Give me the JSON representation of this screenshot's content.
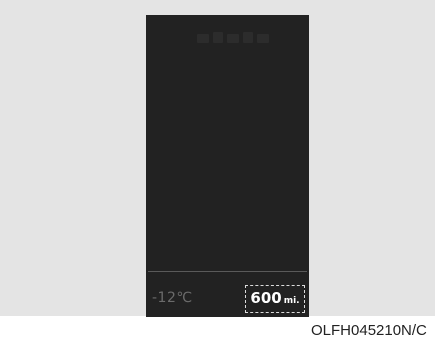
{
  "display": {
    "status_icons": [
      "seatbelt-warning-icon",
      "door-ajar-icon",
      "trunk-open-icon",
      "headlight-icon",
      "fuel-icon"
    ],
    "temperature": "-12℃",
    "range": {
      "value": "600",
      "unit": "mi."
    }
  },
  "caption": "OLFH045210N/C"
}
